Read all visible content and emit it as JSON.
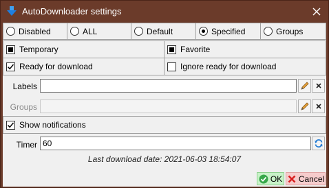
{
  "window": {
    "title": "AutoDownloader settings",
    "title_icon": "download-arrow-icon",
    "close_icon": "close-icon",
    "colors": {
      "titlebar": "#6b3b2a",
      "ok_bg": "#c8f2c8",
      "cancel_bg": "#f6cccc"
    }
  },
  "mode": {
    "options": [
      "Disabled",
      "ALL",
      "Default",
      "Specified",
      "Groups"
    ],
    "selected": "Specified"
  },
  "flags": {
    "temporary": {
      "label": "Temporary",
      "state": "indeterminate"
    },
    "favorite": {
      "label": "Favorite",
      "state": "indeterminate"
    },
    "ready": {
      "label": "Ready for download",
      "state": "checked"
    },
    "ignore_ready": {
      "label": "Ignore ready for download",
      "state": "unchecked"
    }
  },
  "labels": {
    "label": "Labels",
    "value": "",
    "edit_icon": "pencil-icon",
    "clear_icon": "clear-x-icon"
  },
  "groups": {
    "label": "Groups",
    "value": "",
    "disabled": true,
    "edit_icon": "pencil-icon",
    "clear_icon": "clear-x-icon"
  },
  "notifications": {
    "label": "Show notifications",
    "state": "checked"
  },
  "timer": {
    "label": "Timer",
    "value": "60",
    "refresh_icon": "refresh-icon"
  },
  "status": {
    "last_download": "Last download date: 2021-06-03 18:54:07"
  },
  "buttons": {
    "ok": "OK",
    "cancel": "Cancel",
    "ok_icon": "check-icon",
    "cancel_icon": "cancel-x-icon"
  }
}
